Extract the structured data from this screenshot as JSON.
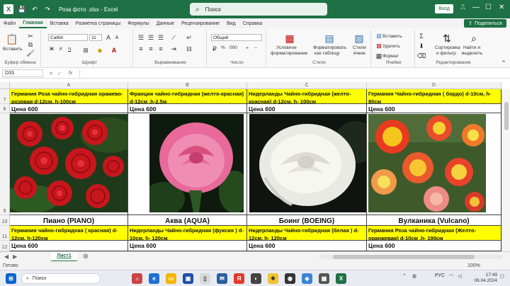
{
  "window": {
    "title": "Роза фото .xlsx  -  Excel",
    "app_icon": "X",
    "search_placeholder": "Поиск",
    "login": "Вход",
    "minimize": "—",
    "maximize": "☐",
    "close": "✕",
    "accent": "#1e7145"
  },
  "tabs": [
    "Файл",
    "Главная",
    "Вставка",
    "Разметка страницы",
    "Формулы",
    "Данные",
    "Рецензирование",
    "Вид",
    "Справка"
  ],
  "active_tab": "Главная",
  "share_label": "Поделиться",
  "ribbon": {
    "clipboard": {
      "paste": "Вставить",
      "label": "Буфер обмена"
    },
    "font": {
      "name": "Calibri",
      "size": "11",
      "label": "Шрифт",
      "bold": "Ж",
      "italic": "К",
      "underline": "Ч"
    },
    "alignment": {
      "label": "Выравнивание"
    },
    "number": {
      "format": "Общий",
      "percent": "%",
      "thousands": "000",
      "label": "Число"
    },
    "styles": {
      "conditional": "Условное",
      "conditional2": "форматирование",
      "as_table": "Форматировать",
      "as_table2": "как таблицу",
      "cell_styles": "Стили",
      "cell_styles2": "ячеек",
      "label": "Стили"
    },
    "cells": {
      "insert": "Вставить",
      "delete": "Удалить",
      "format": "Формат",
      "label": "Ячейки"
    },
    "editing": {
      "sort": "Сортировка",
      "sort2": "и фильтр",
      "find": "Найти и",
      "find2": "выделить",
      "label": "Редактирование"
    }
  },
  "formula_bar": {
    "name_box": "D33",
    "fx": "fx",
    "value": ""
  },
  "columns": [
    "A",
    "B",
    "C",
    "D"
  ],
  "rows": [
    "7",
    "8",
    "9",
    "10",
    "11",
    "12"
  ],
  "grid": {
    "row7": [
      "Германия Роза чайно-гибридная оражево-розовая d-12см, h-100см",
      "Франция чайно-гибридная (желто-красная) d-12см ,h-2,5м",
      "Нидерланды Чайно-гибридная  (желто-красная) d-12см, h- 100см",
      "Германия Чайно-гибридная ( бордо) d-10см, h-80см"
    ],
    "row8": [
      "Цена 600",
      "Цена 600",
      "Цена 600",
      "Цена 600"
    ],
    "row10": [
      "Пиано (PIANO)",
      "Аква (AQUA)",
      "Боинг (BOEING)",
      "Вулканика (Vulcano)"
    ],
    "row11": [
      "Германия чайно-гибридная ( красная) d-12см, h-120см",
      "Нидерланды Чайно-гибридная  (фуксия ) d-10см, h- 120см",
      "Нидерланды Чайно-гибридная (белая ) d-12см, h- 120см",
      "Германия Роза чайно-гибридная (Желто-оранжевая) d-10см  ,h- 190см"
    ],
    "row12": [
      "Цена 600",
      "Цена 600",
      "Цена 600",
      "Цена 600"
    ]
  },
  "photos": [
    "red roses photo",
    "pink rose photo",
    "white rose photo",
    "yellow-red roses photo"
  ],
  "sheet_tab": "Лист1",
  "status": {
    "ready": "Готово",
    "zoom": "100%"
  },
  "taskbar": {
    "search": "Поиск",
    "lang": "РУС",
    "time": "17:49",
    "date": "06.04.2024"
  }
}
